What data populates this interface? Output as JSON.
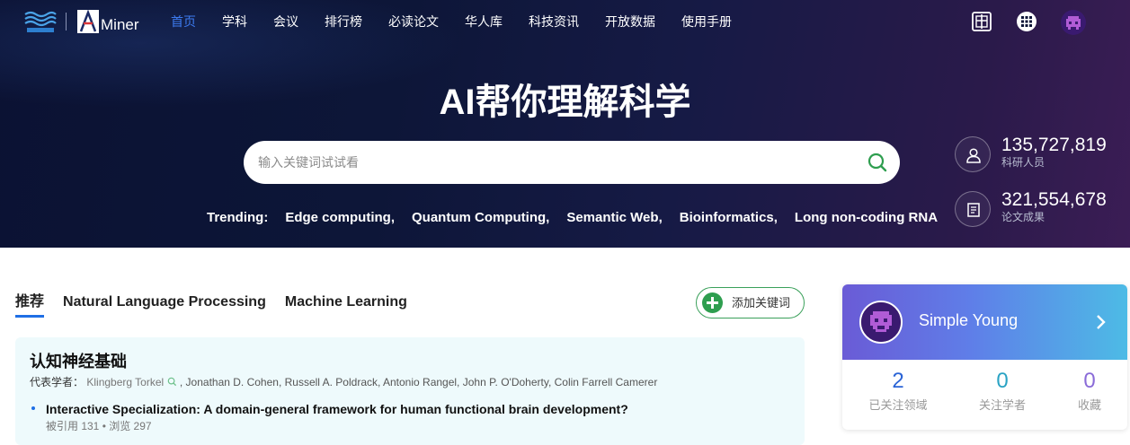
{
  "nav": {
    "items": [
      {
        "label": "首页",
        "active": true
      },
      {
        "label": "学科"
      },
      {
        "label": "会议"
      },
      {
        "label": "排行榜"
      },
      {
        "label": "必读论文"
      },
      {
        "label": "华人库"
      },
      {
        "label": "科技资讯"
      },
      {
        "label": "开放数据"
      },
      {
        "label": "使用手册"
      }
    ],
    "logo_text": "Miner",
    "icons": [
      "language-switch-icon",
      "apps-grid-icon",
      "user-avatar-icon"
    ]
  },
  "hero": {
    "title": "AI帮你理解科学",
    "search_placeholder": "输入关键词试试看",
    "trending_label": "Trending:",
    "trending": [
      "Edge computing,",
      "Quantum Computing,",
      "Semantic Web,",
      "Bioinformatics,",
      "Long non-coding RNA"
    ],
    "stats": [
      {
        "value": "135,727,819",
        "label": "科研人员",
        "icon": "person-icon"
      },
      {
        "value": "321,554,678",
        "label": "论文成果",
        "icon": "paper-icon"
      }
    ]
  },
  "feed": {
    "tabs": [
      {
        "label": "推荐",
        "active": true
      },
      {
        "label": "Natural Language Processing"
      },
      {
        "label": "Machine Learning"
      }
    ],
    "add_keyword_label": "添加关键词",
    "card": {
      "title": "认知神经基础",
      "scholars_label": "代表学者：",
      "first_scholar": "Klingberg Torkel",
      "other_scholars": ", Jonathan D. Cohen, Russell A. Poldrack, Antonio Rangel, John P. O'Doherty, Colin Farrell Camerer",
      "paper_title": "Interactive Specialization: A domain-general framework for human functional brain development?",
      "paper_meta": "被引用   131 •  浏览   297"
    }
  },
  "user_card": {
    "name": "Simple Young",
    "stats": [
      {
        "value": "2",
        "label": "已关注领域"
      },
      {
        "value": "0",
        "label": "关注学者"
      },
      {
        "value": "0",
        "label": "收藏"
      }
    ]
  },
  "colors": {
    "accent_blue": "#1f6fe5",
    "nav_active": "#3d7bf0",
    "add_green": "#2e9e4f",
    "stat_value": "#2b64d6"
  }
}
